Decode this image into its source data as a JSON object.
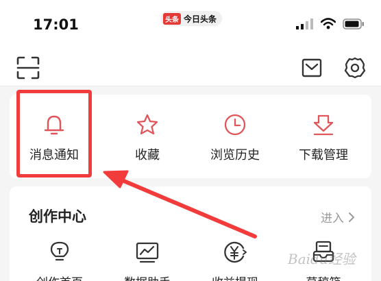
{
  "status": {
    "time": "17:01",
    "app_badge": "头条",
    "app_name": "今日头条"
  },
  "toolbar": {
    "scan_icon": "scan-icon",
    "mail_icon": "mail-icon",
    "settings_icon": "gear-icon"
  },
  "quick": {
    "items": [
      {
        "label": "消息通知",
        "icon": "bell-icon"
      },
      {
        "label": "收藏",
        "icon": "star-icon"
      },
      {
        "label": "浏览历史",
        "icon": "clock-icon"
      },
      {
        "label": "下载管理",
        "icon": "download-icon"
      }
    ]
  },
  "creator": {
    "title": "创作中心",
    "enter_label": "进入",
    "items": [
      {
        "label": "创作首页",
        "icon": "lightbulb-icon"
      },
      {
        "label": "数据助手",
        "icon": "chart-icon"
      },
      {
        "label": "收益提现",
        "icon": "yuan-icon"
      },
      {
        "label": "草稿箱",
        "icon": "drafts-icon"
      }
    ]
  },
  "watermark": "Baidu经验",
  "colors": {
    "accent": "#e0555a",
    "highlight": "#f23c3c",
    "icon_dark": "#333333",
    "muted": "#999999"
  }
}
